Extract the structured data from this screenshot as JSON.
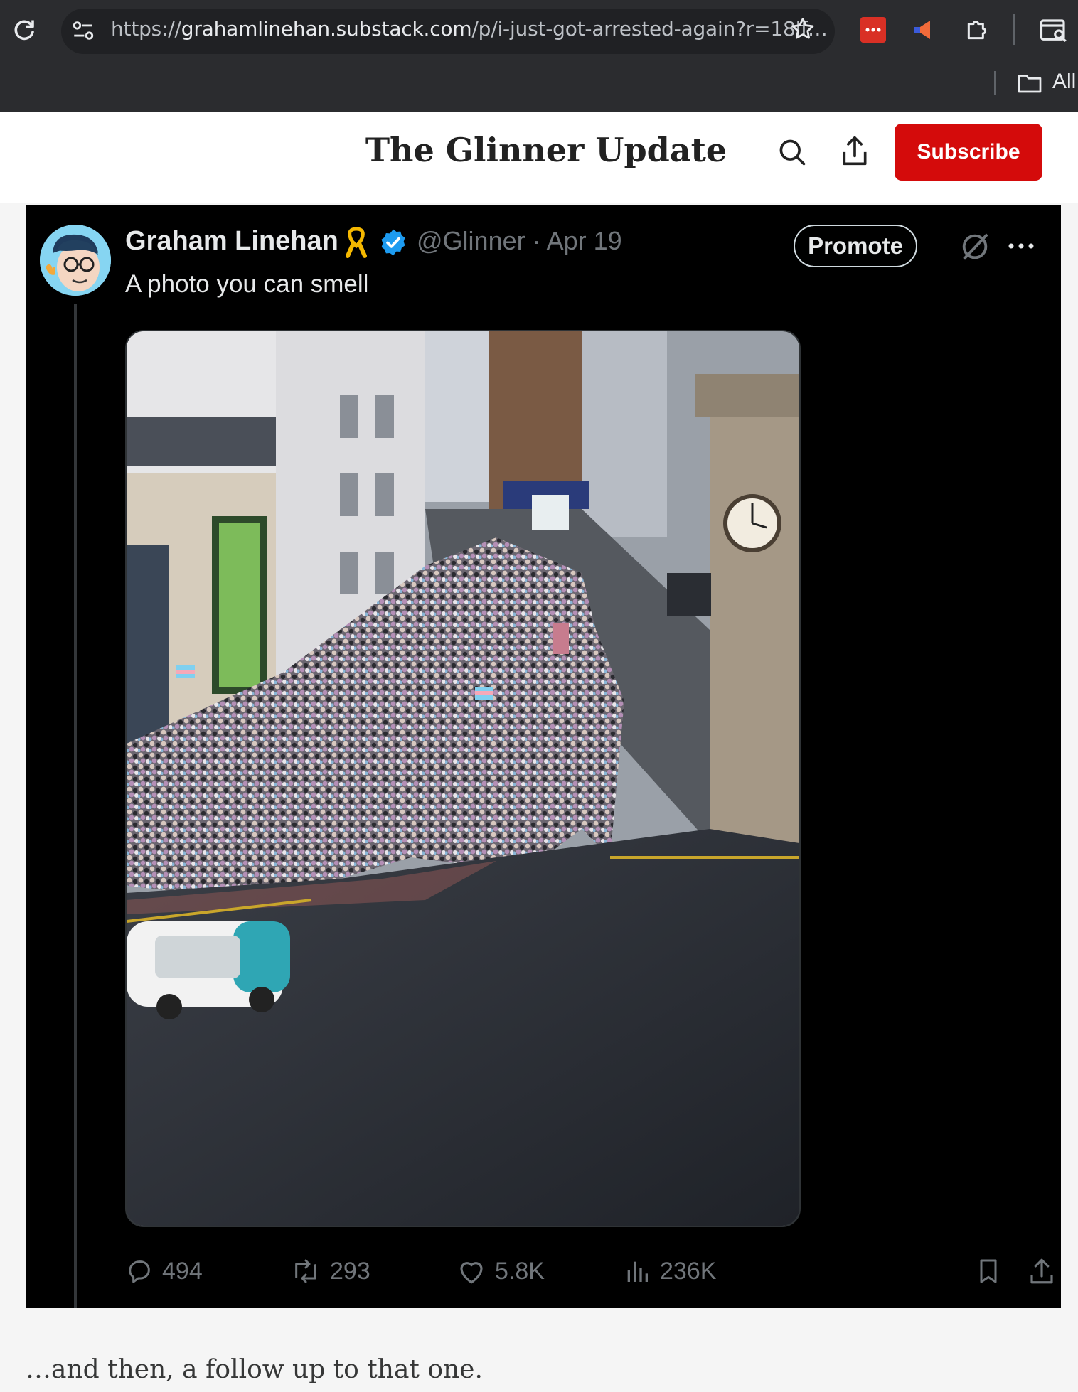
{
  "browser": {
    "url_prefix": "https://",
    "url_domain": "grahamlinehan.substack.com",
    "url_path": "/p/i-just-got-arrested-again?r=18lf…",
    "bookmarks_label": "All",
    "icons": [
      "reload-icon",
      "site-info-icon",
      "bookmark-star-icon",
      "extension-icon",
      "puzzle-icon",
      "reading-list-icon",
      "folder-icon"
    ]
  },
  "publication": {
    "title": "The Glinner Update",
    "subscribe_label": "Subscribe",
    "accent_color": "#d40b0b"
  },
  "tweet": {
    "author_name": "Graham Linehan",
    "handle_and_date": "@Glinner · Apr 19",
    "promote_label": "Promote",
    "text": "A photo you can smell",
    "media_description_icon": "photo-of-crowd",
    "stats": {
      "replies": "494",
      "reposts": "293",
      "likes": "5.8K",
      "views": "236K"
    }
  },
  "article": {
    "paragraph": "…and then, a follow up to that one."
  }
}
